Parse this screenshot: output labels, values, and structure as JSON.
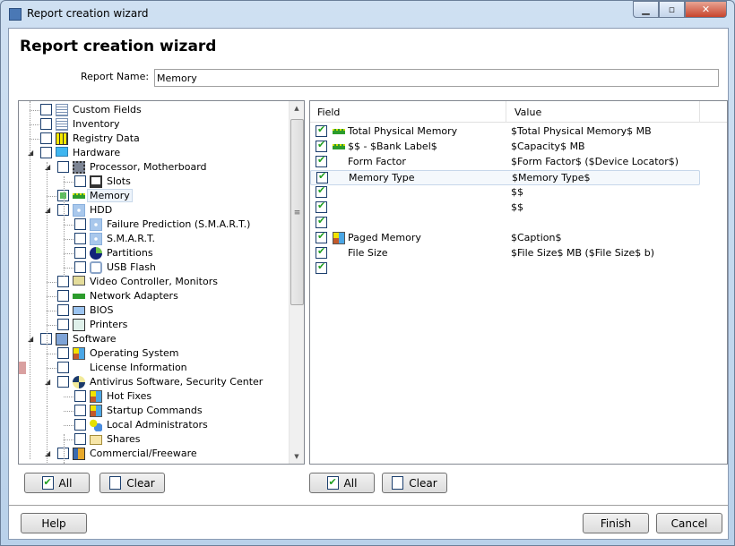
{
  "window": {
    "title": "Report creation wizard",
    "controls": [
      "minimize",
      "maximize",
      "close"
    ]
  },
  "heading": "Report creation wizard",
  "report_name": {
    "label": "Report Name:",
    "value": "Memory"
  },
  "tree": {
    "items": [
      {
        "label": "Custom Fields",
        "level": 0,
        "icon": "document-icon",
        "state": "unchecked"
      },
      {
        "label": "Inventory",
        "level": 0,
        "icon": "document-icon",
        "state": "unchecked"
      },
      {
        "label": "Registry Data",
        "level": 0,
        "icon": "grid-icon",
        "state": "unchecked"
      },
      {
        "label": "Hardware",
        "level": 0,
        "icon": "monitor-icon",
        "state": "unchecked",
        "expanded": true
      },
      {
        "label": "Processor, Motherboard",
        "level": 1,
        "icon": "cpu-icon",
        "state": "unchecked",
        "expanded": true
      },
      {
        "label": "Slots",
        "level": 2,
        "icon": "slot-icon",
        "state": "unchecked"
      },
      {
        "label": "Memory",
        "level": 1,
        "icon": "ram-icon",
        "state": "partial",
        "selected": true
      },
      {
        "label": "HDD",
        "level": 1,
        "icon": "disk-icon",
        "state": "unchecked",
        "expanded": true
      },
      {
        "label": "Failure Prediction (S.M.A.R.T.)",
        "level": 2,
        "icon": "disk-icon",
        "state": "unchecked"
      },
      {
        "label": "S.M.A.R.T.",
        "level": 2,
        "icon": "disk-icon",
        "state": "unchecked"
      },
      {
        "label": "Partitions",
        "level": 2,
        "icon": "pie-icon",
        "state": "unchecked"
      },
      {
        "label": "USB Flash",
        "level": 2,
        "icon": "usb-icon",
        "state": "unchecked"
      },
      {
        "label": "Video Controller, Monitors",
        "level": 1,
        "icon": "display-icon",
        "state": "unchecked"
      },
      {
        "label": "Network Adapters",
        "level": 1,
        "icon": "network-card-icon",
        "state": "unchecked"
      },
      {
        "label": "BIOS",
        "level": 1,
        "icon": "bios-chip-icon",
        "state": "unchecked"
      },
      {
        "label": "Printers",
        "level": 1,
        "icon": "printer-icon",
        "state": "unchecked"
      },
      {
        "label": "Software",
        "level": 0,
        "icon": "software-icon",
        "state": "unchecked",
        "expanded": true
      },
      {
        "label": "Operating System",
        "level": 1,
        "icon": "windows-icon",
        "state": "unchecked"
      },
      {
        "label": "License Information",
        "level": 1,
        "icon": "key-icon",
        "state": "unchecked"
      },
      {
        "label": "Antivirus Software, Security Center",
        "level": 1,
        "icon": "shield-icon",
        "state": "unchecked",
        "expanded": true
      },
      {
        "label": "Hot Fixes",
        "level": 2,
        "icon": "windows-icon",
        "state": "unchecked"
      },
      {
        "label": "Startup Commands",
        "level": 2,
        "icon": "windows-icon",
        "state": "unchecked"
      },
      {
        "label": "Local Administrators",
        "level": 2,
        "icon": "users-icon",
        "state": "unchecked"
      },
      {
        "label": "Shares",
        "level": 2,
        "icon": "folder-icon",
        "state": "unchecked"
      },
      {
        "label": "Commercial/Freeware",
        "level": 1,
        "icon": "package-icon",
        "state": "unchecked",
        "expanded": true
      }
    ]
  },
  "fields": {
    "columns": [
      "Field",
      "Value"
    ],
    "rows": [
      {
        "field": "Total Physical Memory",
        "value": "$Total Physical Memory$ MB",
        "icon": "ram-icon",
        "checked": true
      },
      {
        "field": "$$ - $Bank Label$",
        "value": "$Capacity$ MB",
        "icon": "ram-icon",
        "checked": true
      },
      {
        "field": "Form Factor",
        "value": "$Form Factor$ ($Device Locator$)",
        "checked": true
      },
      {
        "field": "Memory Type",
        "value": "$Memory Type$",
        "checked": true,
        "selected": true
      },
      {
        "field": "",
        "value": "$$",
        "checked": true
      },
      {
        "field": "",
        "value": "$$",
        "checked": true
      },
      {
        "field": "",
        "value": "",
        "checked": true
      },
      {
        "field": "Paged Memory",
        "value": "$Caption$",
        "icon": "windows-icon",
        "checked": true
      },
      {
        "field": "File Size",
        "value": "$File Size$ MB ($File Size$ b)",
        "checked": true
      },
      {
        "field": "",
        "value": "",
        "checked": true
      }
    ]
  },
  "buttons": {
    "all": "All",
    "clear": "Clear",
    "help": "Help",
    "finish": "Finish",
    "cancel": "Cancel"
  },
  "colors": {
    "check": "#1fa01f",
    "partial": "#5cbf5c",
    "frame": "#b9d1ea",
    "close": "#c7442c"
  }
}
